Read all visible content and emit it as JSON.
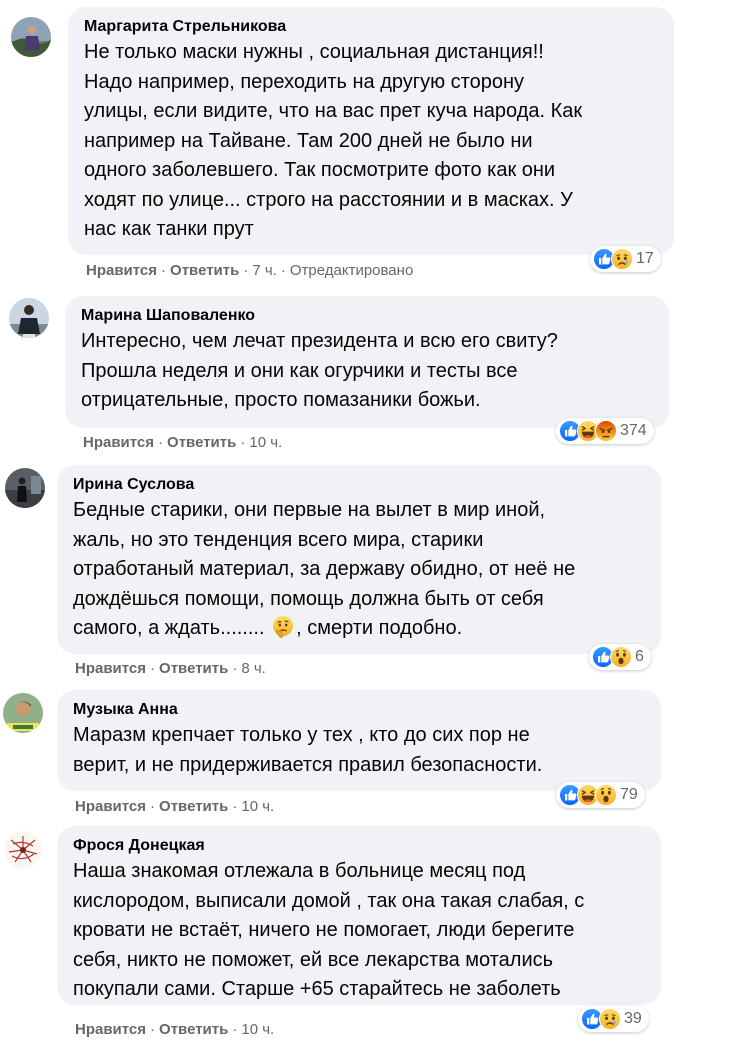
{
  "labels": {
    "like": "Нравится",
    "reply": "Ответить",
    "sep": "·"
  },
  "comments": [
    {
      "author": "Маргарита Стрельникова",
      "text": "Не только маски нужны , социальная дистанция!!\nНадо например, переходить на другую сторону\nулицы, если видите, что на вас прет куча народа. Как\nнапример на Тайване. Там 200 дней не было ни\nодного заболевшего. Так посмотрите фото как они\nходят по улице... строго на расстоянии и в масках. У\nнас как танки прут",
      "time": "7 ч.",
      "edited": "Отредактировано",
      "reactions": [
        "like-icon",
        "sad-icon"
      ],
      "count": "17"
    },
    {
      "author": "Марина Шаповаленко",
      "text": "Интересно, чем лечат президента и всю его свиту?\nПрошла неделя и они как огурчики и тесты все\nотрицательные, просто помазаники божьи.",
      "time": "10 ч.",
      "reactions": [
        "like-icon",
        "haha-icon",
        "angry-icon"
      ],
      "count": "374"
    },
    {
      "author": "Ирина Суслова",
      "text_lines": [
        "Бедные старики, они первые на вылет в мир иной,",
        "жаль, но это тенденция всего мира, старики",
        "отработаный материал, за державу обидно, от неё не",
        "дождёшься помощи, помощь должна быть от себя"
      ],
      "text_last_before": "самого, а ждать........ ",
      "text_last_after": ", смерти подобно.",
      "inline_emoji": "thinking-face-icon",
      "time": "8 ч.",
      "reactions": [
        "like-icon",
        "wow-icon"
      ],
      "count": "6"
    },
    {
      "author": "Музыка Анна",
      "text": "Маразм крепчает только у тех , кто до сих пор не\nверит, и не придерживается правил безопасности.",
      "time": "10 ч.",
      "reactions": [
        "like-icon",
        "haha-icon",
        "wow-icon"
      ],
      "count": "79"
    },
    {
      "author": "Фрося Донецкая",
      "text": "Наша знакомая отлежала в больнице месяц под\nкислородом, выписали домой , так она такая слабая, с\nкровати не встаёт, ничего не помогает, люди берегите\nсебя, никто не поможет, ей все лекарства мотались\nпокупали сами. Старше +65 старайтесь не заболеть",
      "time": "10 ч.",
      "reactions": [
        "like-icon",
        "sad-icon"
      ],
      "count": "39"
    }
  ],
  "colors": {
    "bubble": "#f0f2f5",
    "meta": "#65676b",
    "like": "#1877f2",
    "emoji": "#f7b125",
    "angry": "#e9710f"
  }
}
